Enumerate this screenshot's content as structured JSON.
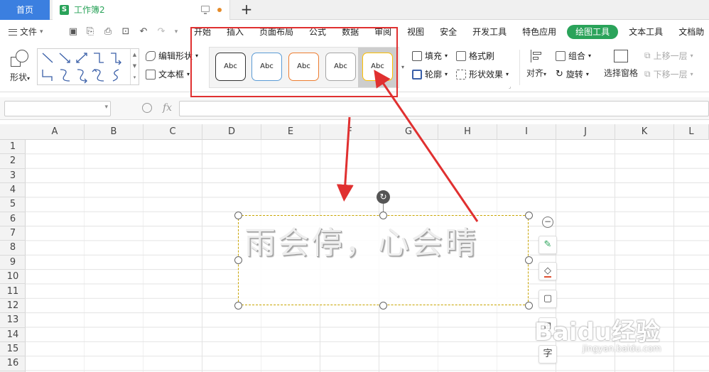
{
  "tabs": {
    "home": "首页",
    "doc_icon": "S",
    "doc_name": "工作簿2",
    "add": "+"
  },
  "menu": {
    "file": "文件",
    "items": [
      "开始",
      "插入",
      "页面布局",
      "公式",
      "数据",
      "审阅",
      "视图",
      "安全",
      "开发工具",
      "特色应用",
      "绘图工具",
      "文本工具",
      "文档助"
    ],
    "active_index": 10
  },
  "ribbon": {
    "shape_label": "形状",
    "edit_shape": "编辑形状",
    "text_box": "文本框",
    "style_preview_text": "Abc",
    "styles": [
      {
        "border": "#333333",
        "selected": false
      },
      {
        "border": "#5b9bd5",
        "selected": false
      },
      {
        "border": "#ed7d31",
        "selected": false
      },
      {
        "border": "#a5a5a5",
        "selected": false
      },
      {
        "border": "#ffc000",
        "selected": true
      }
    ],
    "fill": "填充",
    "format_painter": "格式刷",
    "outline": "轮廓",
    "shape_effect": "形状效果",
    "align": "对齐",
    "group": "组合",
    "rotate": "旋转",
    "selection_pane": "选择窗格",
    "bring_forward": "上移一层",
    "send_backward": "下移一层"
  },
  "formula_bar": {
    "fx": "fx"
  },
  "sheet": {
    "columns": [
      "A",
      "B",
      "C",
      "D",
      "E",
      "F",
      "G",
      "H",
      "I",
      "J",
      "K",
      "L"
    ],
    "rows": [
      "1",
      "2",
      "3",
      "4",
      "5",
      "6",
      "7",
      "8",
      "9",
      "10",
      "11",
      "12",
      "13",
      "14",
      "15",
      "16"
    ]
  },
  "textbox": {
    "text": "雨会停，心会晴",
    "border_color": "#e6c300"
  },
  "watermark": {
    "main": "Baidu经验",
    "sub": "jingyan.baidu.com"
  },
  "colors": {
    "accent_green": "#2aa35a",
    "home_blue": "#3b7fe0",
    "annotation_red": "#e03030"
  }
}
